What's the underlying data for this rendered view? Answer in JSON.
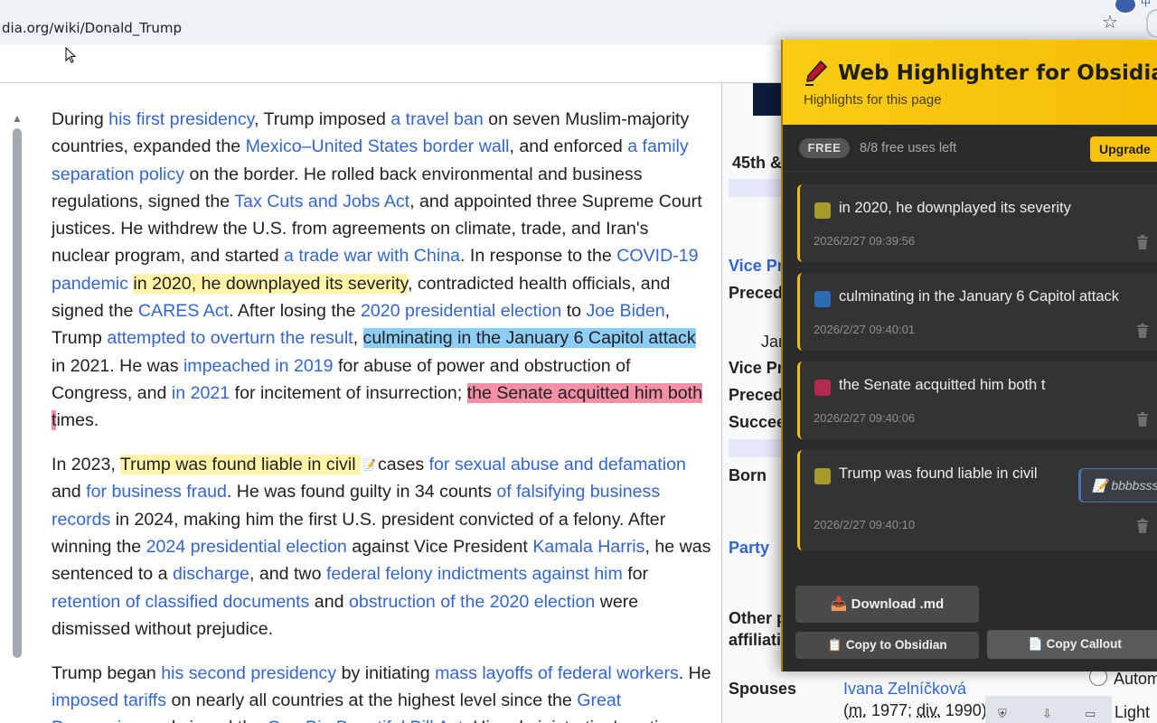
{
  "browser": {
    "url": "dia.org/wiki/Donald_Trump",
    "star_icon": "star-icon"
  },
  "article": {
    "paragraphs": [
      {
        "segments": [
          {
            "t": "During "
          },
          {
            "t": "his first presidency",
            "link": true
          },
          {
            "t": ", Trump imposed "
          },
          {
            "t": "a travel ban",
            "link": true
          },
          {
            "t": " on seven Muslim-majority countries, expanded the "
          },
          {
            "t": "Mexico–United States border wall",
            "link": true
          },
          {
            "t": ", and enforced "
          },
          {
            "t": "a family separation policy",
            "link": true
          },
          {
            "t": " on the border. He rolled back environmental and business regulations, signed the "
          },
          {
            "t": "Tax Cuts and Jobs Act",
            "link": true
          },
          {
            "t": ", and appointed three Supreme Court justices. He withdrew the U.S. from agreements on climate, trade, and Iran's nuclear program, and started "
          },
          {
            "t": "a trade war with China",
            "link": true
          },
          {
            "t": ". In response to the "
          },
          {
            "t": "COVID-19 pandemic",
            "link": true
          },
          {
            "t": " "
          },
          {
            "t": "in 2020, he downplayed its severity",
            "hl": "yellow"
          },
          {
            "t": ", contradicted health officials, and signed the "
          },
          {
            "t": "CARES Act",
            "link": true
          },
          {
            "t": ". After losing the "
          },
          {
            "t": "2020 presidential election",
            "link": true
          },
          {
            "t": " to "
          },
          {
            "t": "Joe Biden",
            "link": true
          },
          {
            "t": ", Trump "
          },
          {
            "t": "attempted to overturn the result",
            "link": true
          },
          {
            "t": ", "
          },
          {
            "t": "culminating in the January 6 Capitol attack",
            "hl": "blue"
          },
          {
            "t": " in 2021. He was "
          },
          {
            "t": "impeached in 2019",
            "link": true
          },
          {
            "t": " for abuse of power and obstruction of Congress, and "
          },
          {
            "t": "in 2021",
            "link": true
          },
          {
            "t": " for incitement of insurrection; "
          },
          {
            "t": "the Senate acquitted him both t",
            "hl": "pink"
          },
          {
            "t": "imes."
          }
        ]
      },
      {
        "segments": [
          {
            "t": "In 2023, "
          },
          {
            "t": "Trump was found liable in civil ",
            "hl": "yellow"
          },
          {
            "t": "",
            "note": true
          },
          {
            "t": "cases "
          },
          {
            "t": "for sexual abuse and defamation",
            "link": true
          },
          {
            "t": " and "
          },
          {
            "t": "for business fraud",
            "link": true
          },
          {
            "t": ". He was found guilty in 34 counts "
          },
          {
            "t": "of falsifying business records",
            "link": true
          },
          {
            "t": " in 2024, making him the first U.S. president convicted of a felony. After winning the "
          },
          {
            "t": "2024 presidential election",
            "link": true
          },
          {
            "t": " against Vice President "
          },
          {
            "t": "Kamala Harris",
            "link": true
          },
          {
            "t": ", he was sentenced to a "
          },
          {
            "t": "discharge",
            "link": true
          },
          {
            "t": ", and two "
          },
          {
            "t": "federal felony indictments against him",
            "link": true
          },
          {
            "t": " for "
          },
          {
            "t": "retention of classified documents",
            "link": true
          },
          {
            "t": " and "
          },
          {
            "t": "obstruction of the 2020 election",
            "link": true
          },
          {
            "t": " were dismissed without prejudice."
          }
        ]
      },
      {
        "segments": [
          {
            "t": "Trump began "
          },
          {
            "t": "his second presidency",
            "link": true
          },
          {
            "t": " by initiating "
          },
          {
            "t": "mass layoffs of federal workers",
            "link": true
          },
          {
            "t": ". He "
          },
          {
            "t": "imposed tariffs",
            "link": true
          },
          {
            "t": " on nearly all countries at the highest level since the "
          },
          {
            "t": "Great Depression",
            "link": true
          },
          {
            "t": " and signed the "
          },
          {
            "t": "One Big Beautiful Bill Act",
            "link": true
          },
          {
            "t": ". His administration's actions—"
          }
        ]
      }
    ]
  },
  "infobox": {
    "header_partial": "45th &",
    "vice_pres_1": "Vice Pre",
    "preceded_1": "Precede",
    "jan_partial": "Jar",
    "vice_pres_2": "Vice Pre",
    "preceded_2": "Precede",
    "succeeded": "Succee",
    "born": "Born",
    "party": "Party",
    "other_party_1": "Other p",
    "other_party_2": "affiliati",
    "spouses": "Spouses",
    "spouse_name": "Ivana Zelníčková",
    "spouse_dates_prefix": "(",
    "spouse_m": "m.",
    "spouse_year_1": " 1977; ",
    "spouse_div": "div.",
    "spouse_year_2": " 1990)",
    "radio_label": "Autom",
    "light_label": "Light"
  },
  "panel": {
    "title": "Web Highlighter for Obsidian",
    "subtitle": "Highlights for this page",
    "free_badge": "FREE",
    "free_uses": "8/8 free uses left",
    "upgrade_label": "Upgrade",
    "highlights": [
      {
        "text": "in 2020, he downplayed its severity",
        "time": "2026/2/27 09:39:56",
        "color": "#a59a2c"
      },
      {
        "text": "culminating in the January 6 Capitol attack",
        "time": "2026/2/27 09:40:01",
        "color": "#2b6cb5"
      },
      {
        "text": "the Senate acquitted him both t",
        "time": "2026/2/27 09:40:06",
        "color": "#b4294f"
      },
      {
        "text": "Trump was found liable in civil",
        "time": "2026/2/27 09:40:10",
        "color": "#a59a2c",
        "note": "bbbbsss"
      }
    ],
    "download_label": "Download .md",
    "copy_obsidian_label": "Copy to Obsidian",
    "copy_callout_label": "Copy Callout"
  },
  "colors": {
    "accent_yellow": "#f7c20b",
    "link_blue": "#3366cc",
    "panel_bg": "#2b2b2b"
  }
}
